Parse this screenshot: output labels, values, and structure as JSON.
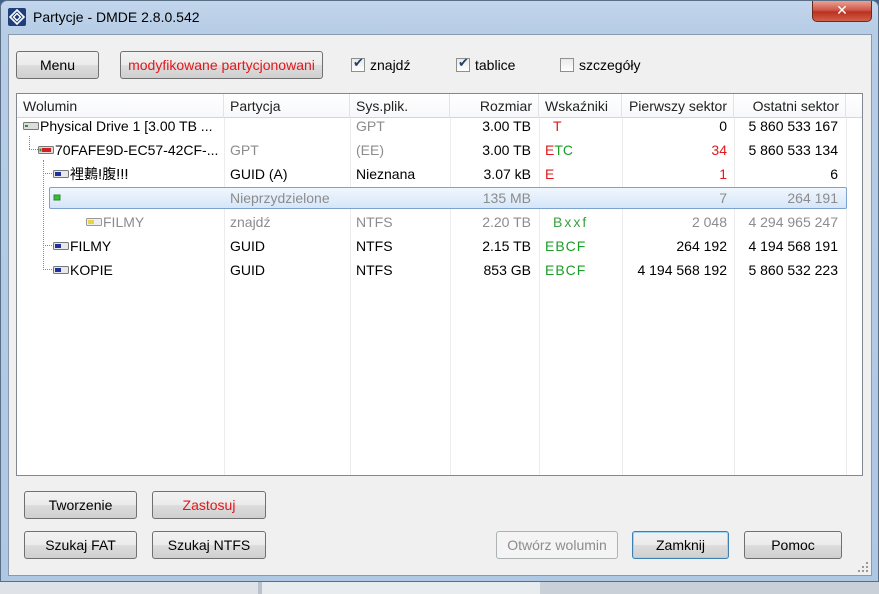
{
  "window": {
    "title": "Partycje - DMDE 2.8.0.542",
    "close_glyph": "✕"
  },
  "toolbar": {
    "menu_label": "Menu",
    "mode_label": "modyfikowane partycjonowani",
    "checkboxes": [
      {
        "label": "znajdź",
        "checked": true
      },
      {
        "label": "tablice",
        "checked": true
      },
      {
        "label": "szczegóły",
        "checked": false
      }
    ]
  },
  "table": {
    "columns": [
      "Wolumin",
      "Partycja",
      "Sys.plik.",
      "Rozmiar",
      "Wskaźniki",
      "Pierwszy sektor",
      "Ostatni sektor"
    ],
    "rows": [
      {
        "volume": "Physical Drive 1 [3.00 TB ...",
        "partition": "",
        "fs": "GPT",
        "size": "3.00 TB",
        "flags": "T",
        "first": "0",
        "last": "5 860 533 167",
        "icon": "physical-drive-icon"
      },
      {
        "volume": "70FAFE9D-EC57-42CF-...",
        "partition": "GPT",
        "fs": "(EE)",
        "size": "3.00 TB",
        "flags": "ETC",
        "first": "34",
        "last": "5 860 533 134",
        "icon": "gpt-disk-icon"
      },
      {
        "volume": "裡鶈ⵑ腹ⵑⵑⵑ",
        "partition": "GUID (A)",
        "fs": "Nieznana",
        "size": "3.07 kB",
        "flags": "E",
        "first": "1",
        "last": "6",
        "icon": "unknown-partition-icon"
      },
      {
        "volume": "",
        "partition": "Nieprzydzielone",
        "fs": "",
        "size": "135 MB",
        "flags": "",
        "first": "7",
        "last": "264 191",
        "icon": "unallocated-icon"
      },
      {
        "volume": "FILMY",
        "partition": "znajdź",
        "fs": "NTFS",
        "size": "2.20 TB",
        "flags": "Bxxf",
        "first": "2 048",
        "last": "4 294 965 247",
        "icon": "found-volume-icon"
      },
      {
        "volume": "FILMY",
        "partition": "GUID",
        "fs": "NTFS",
        "size": "2.15 TB",
        "flags": "EBCF",
        "first": "264 192",
        "last": "4 194 568 191",
        "icon": "ntfs-volume-icon"
      },
      {
        "volume": "KOPIE",
        "partition": "GUID",
        "fs": "NTFS",
        "size": "853 GB",
        "flags": "EBCF",
        "first": "4 194 568 192",
        "last": "5 860 532 223",
        "icon": "ntfs-volume-icon"
      }
    ]
  },
  "buttons": {
    "create": "Tworzenie",
    "apply": "Zastosuj",
    "search_fat": "Szukaj FAT",
    "search_ntfs": "Szukaj NTFS",
    "open_volume": "Otwórz wolumin",
    "close": "Zamknij",
    "help": "Pomoc"
  },
  "colors": {
    "error_red": "#e0181b",
    "flag_green": "#1a9e28",
    "disabled_grey": "#8c8c8c",
    "selection_blue": "#d5e6f9"
  }
}
